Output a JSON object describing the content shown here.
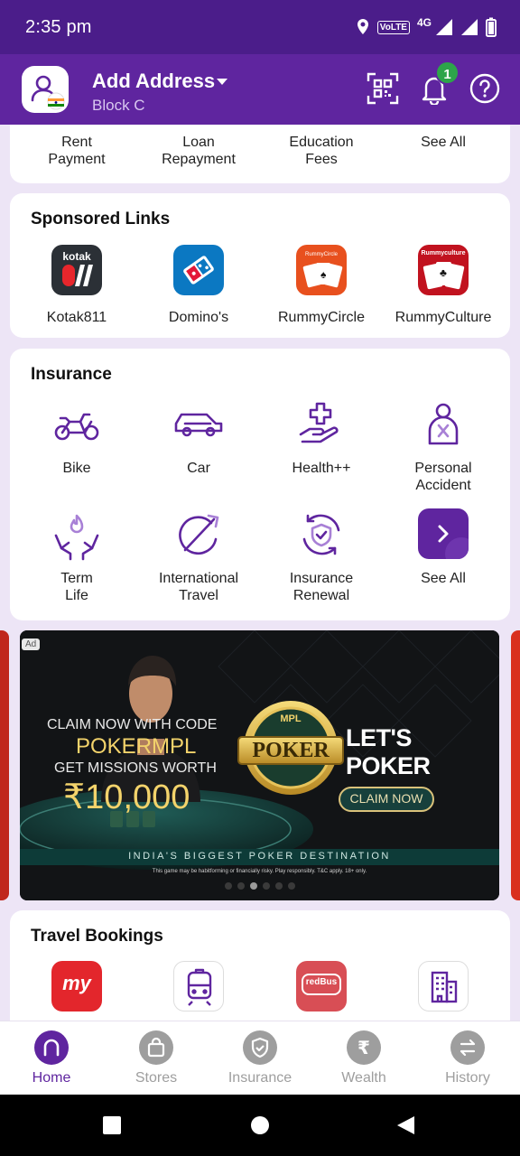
{
  "status_bar": {
    "time": "2:35 pm",
    "volte": "VoLTE",
    "network": "4G"
  },
  "header": {
    "title": "Add Address",
    "subtitle": "Block C",
    "notification_count": "1"
  },
  "payments_row": [
    {
      "label_line1": "Rent",
      "label_line2": "Payment"
    },
    {
      "label_line1": "Loan",
      "label_line2": "Repayment"
    },
    {
      "label_line1": "Education",
      "label_line2": "Fees"
    },
    {
      "label_line1": "See All",
      "label_line2": ""
    }
  ],
  "sponsored": {
    "title": "Sponsored Links",
    "items": [
      {
        "label": "Kotak811",
        "tile_text": "kotak",
        "color": "#2b3036"
      },
      {
        "label": "Domino's",
        "color": "#0b78c2"
      },
      {
        "label": "RummyCircle",
        "tile_text": "RummyCircle",
        "color": "#e8501e"
      },
      {
        "label": "RummyCulture",
        "tile_text": "Rummyculture",
        "color": "#c1121f"
      }
    ]
  },
  "insurance": {
    "title": "Insurance",
    "items": [
      {
        "label_line1": "Bike",
        "label_line2": "",
        "icon": "bike-icon"
      },
      {
        "label_line1": "Car",
        "label_line2": "",
        "icon": "car-icon"
      },
      {
        "label_line1": "Health++",
        "label_line2": "",
        "icon": "health-icon"
      },
      {
        "label_line1": "Personal",
        "label_line2": "Accident",
        "icon": "personal-accident-icon"
      },
      {
        "label_line1": "Term",
        "label_line2": "Life",
        "icon": "term-life-icon"
      },
      {
        "label_line1": "International",
        "label_line2": "Travel",
        "icon": "travel-plane-icon"
      },
      {
        "label_line1": "Insurance",
        "label_line2": "Renewal",
        "icon": "renewal-shield-icon"
      },
      {
        "label_line1": "See All",
        "label_line2": "",
        "icon": "chevron-right-icon"
      }
    ]
  },
  "banner": {
    "ad_tag": "Ad",
    "line1": "CLAIM NOW WITH CODE",
    "code": "POKERMPL",
    "line3": "GET MISSIONS WORTH",
    "amount": "₹10,000",
    "logo_top": "MPL",
    "logo_main": "POKER",
    "tagline": "LET'S POKER",
    "cta": "CLAIM NOW",
    "strip": "INDIA'S BIGGEST POKER DESTINATION",
    "disclaimer": "This game may be habitforming or financially risky. Play responsibly. T&C apply. 18+ only.",
    "dots": 6,
    "active_dot": 3
  },
  "travel": {
    "title": "Travel Bookings",
    "items": [
      {
        "name": "MakeMyTrip",
        "tile_text": "my",
        "color": "#e3262c"
      },
      {
        "name": "Train",
        "color": "#5f259f"
      },
      {
        "name": "redBus",
        "tile_text": "redBus",
        "color": "#d84e55"
      },
      {
        "name": "Hotels",
        "color": "#5f259f"
      }
    ]
  },
  "bottom_nav": [
    {
      "label": "Home",
      "active": true
    },
    {
      "label": "Stores"
    },
    {
      "label": "Insurance"
    },
    {
      "label": "Wealth"
    },
    {
      "label": "History"
    }
  ],
  "colors": {
    "brand": "#5f259f",
    "brand_dark": "#4b1d8a",
    "background": "#ede5f6",
    "badge_green": "#2da44a"
  }
}
